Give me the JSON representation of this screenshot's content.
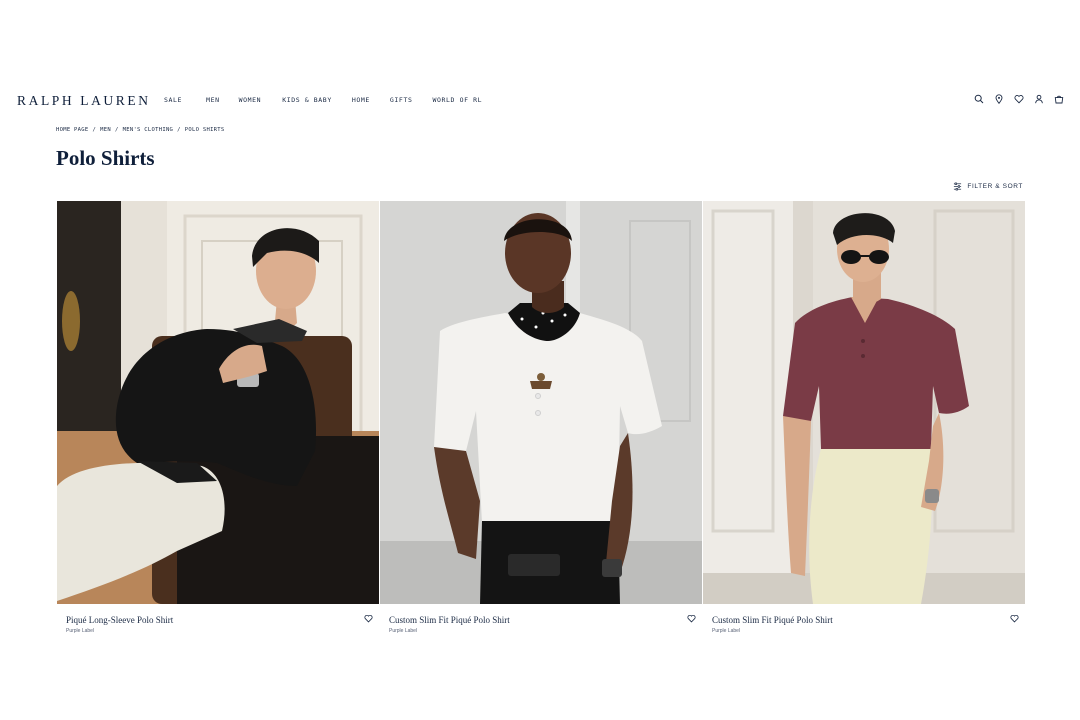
{
  "header": {
    "logo": "RALPH LAUREN",
    "nav": [
      "SALE",
      "MEN",
      "WOMEN",
      "KIDS & BABY",
      "HOME",
      "GIFTS",
      "WORLD OF RL"
    ],
    "utility_icons": [
      "search-icon",
      "location-icon",
      "heart-icon",
      "account-icon",
      "bag-icon"
    ]
  },
  "breadcrumb": [
    "HOME PAGE",
    "MEN",
    "MEN'S CLOTHING",
    "POLO SHIRTS"
  ],
  "page_title": "Polo Shirts",
  "filter_label": "FILTER & SORT",
  "products": [
    {
      "name": "Piqué Long-Sleeve Polo Shirt",
      "brand": "Purple Label",
      "shirt_color": "#151515",
      "pants_color": "#e9e6dc"
    },
    {
      "name": "Custom Slim Fit Piqué Polo Shirt",
      "brand": "Purple Label",
      "shirt_color": "#f3f2ef",
      "pants_color": "#141414"
    },
    {
      "name": "Custom Slim Fit Piqué Polo Shirt",
      "brand": "Purple Label",
      "shirt_color": "#7a3b46",
      "pants_color": "#ece9c9"
    }
  ],
  "colors": {
    "text": "#1b2a44",
    "logo": "#0f1f3a",
    "background": "#ffffff"
  }
}
